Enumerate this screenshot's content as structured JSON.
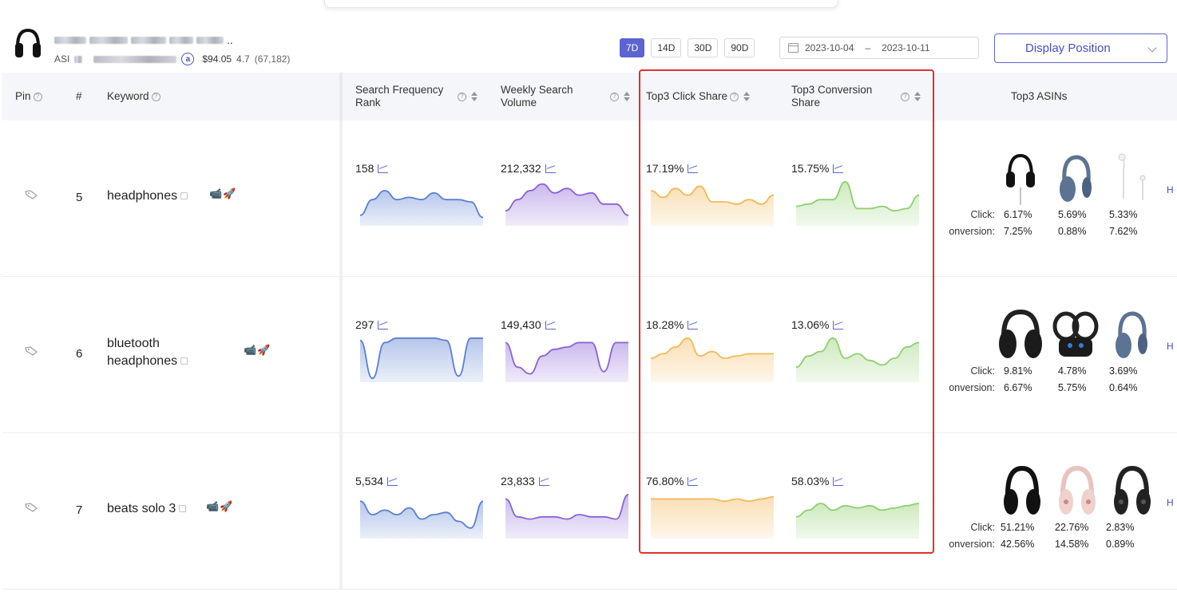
{
  "product": {
    "name_suffix": "..",
    "asin_label": "ASI",
    "badge": "a",
    "price": "$94.05",
    "rating": "4.7",
    "reviews": "(67,182)"
  },
  "range_buttons": [
    "7D",
    "14D",
    "30D",
    "90D"
  ],
  "active_range": "7D",
  "date_range": {
    "start": "2023-10-04",
    "separator": "–",
    "end": "2023-10-11"
  },
  "display_position": "Display Position",
  "columns": {
    "pin": "Pin",
    "num": "#",
    "keyword": "Keyword",
    "sfr": "Search Frequency Rank",
    "wsv": "Weekly Search Volume",
    "click": "Top3 Click Share",
    "conv": "Top3 Conversion Share",
    "asins": "Top3 ASINs"
  },
  "labels": {
    "click": "Click:",
    "conversion": "onversion:",
    "more": "H"
  },
  "rows": [
    {
      "num": "5",
      "keyword": "headphones",
      "sfr": "158",
      "wsv": "212,332",
      "click": "17.19%",
      "conv": "15.75%",
      "asin_click": [
        "6.17%",
        "5.69%",
        "5.33%"
      ],
      "asin_conv": [
        "7.25%",
        "0.88%",
        "7.62%"
      ]
    },
    {
      "num": "6",
      "keyword_line1": "bluetooth",
      "keyword_line2": "headphones",
      "sfr": "297",
      "wsv": "149,430",
      "click": "18.28%",
      "conv": "13.06%",
      "asin_click": [
        "9.81%",
        "4.78%",
        "3.69%"
      ],
      "asin_conv": [
        "6.67%",
        "5.75%",
        "0.64%"
      ]
    },
    {
      "num": "7",
      "keyword": "beats solo 3",
      "sfr": "5,534",
      "wsv": "23,833",
      "click": "76.80%",
      "conv": "58.03%",
      "asin_click": [
        "51.21%",
        "22.76%",
        "2.83%"
      ],
      "asin_conv": [
        "42.56%",
        "14.58%",
        "0.89%"
      ]
    }
  ],
  "colors": {
    "accent": "#5b64cf",
    "sfr": "#5b7fd1",
    "wsv": "#8a62d6",
    "click": "#f3b85a",
    "conv": "#8fcf6e",
    "highlight": "#e0312f"
  },
  "sparklines": {
    "sfr": [
      [
        0.2,
        0.55,
        0.75,
        0.55,
        0.6,
        0.55,
        0.7,
        0.55,
        0.55,
        0.5,
        0.15
      ],
      [
        0.9,
        0.05,
        0.85,
        0.95,
        0.95,
        0.95,
        0.95,
        0.9,
        0.1,
        0.95,
        0.95
      ],
      [
        0.8,
        0.5,
        0.6,
        0.5,
        0.65,
        0.4,
        0.5,
        0.55,
        0.35,
        0.2,
        0.8
      ]
    ],
    "wsv": [
      [
        0.3,
        0.55,
        0.75,
        0.9,
        0.7,
        0.8,
        0.65,
        0.7,
        0.45,
        0.45,
        0.2
      ],
      [
        0.85,
        0.3,
        0.15,
        0.55,
        0.7,
        0.75,
        0.85,
        0.85,
        0.2,
        0.85,
        0.85
      ],
      [
        0.85,
        0.45,
        0.4,
        0.45,
        0.45,
        0.4,
        0.5,
        0.45,
        0.45,
        0.4,
        0.95
      ]
    ],
    "click": [
      [
        0.75,
        0.6,
        0.8,
        0.65,
        0.85,
        0.5,
        0.5,
        0.45,
        0.55,
        0.45,
        0.65
      ],
      [
        0.5,
        0.6,
        0.75,
        0.95,
        0.55,
        0.65,
        0.5,
        0.55,
        0.6,
        0.6,
        0.6
      ],
      [
        0.85,
        0.85,
        0.85,
        0.85,
        0.85,
        0.85,
        0.8,
        0.85,
        0.8,
        0.85,
        0.9
      ]
    ],
    "conv": [
      [
        0.4,
        0.45,
        0.55,
        0.55,
        0.95,
        0.35,
        0.35,
        0.4,
        0.3,
        0.35,
        0.65
      ],
      [
        0.3,
        0.55,
        0.65,
        0.95,
        0.5,
        0.6,
        0.45,
        0.35,
        0.5,
        0.75,
        0.85
      ],
      [
        0.45,
        0.6,
        0.75,
        0.6,
        0.7,
        0.65,
        0.7,
        0.6,
        0.65,
        0.7,
        0.75
      ]
    ]
  }
}
